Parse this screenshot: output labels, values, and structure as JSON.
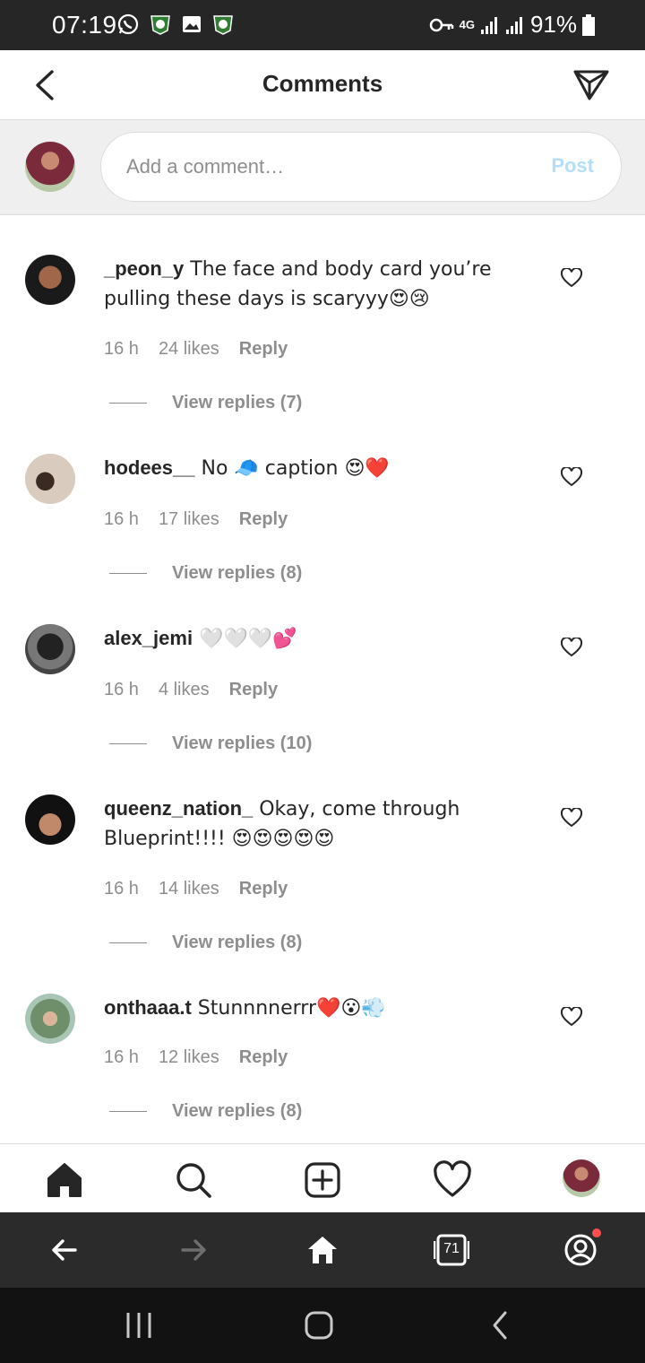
{
  "status_bar": {
    "time": "07:19",
    "network": "4G",
    "battery": "91%"
  },
  "header": {
    "title": "Comments"
  },
  "composer": {
    "placeholder": "Add a comment…",
    "post_label": "Post"
  },
  "comments": [
    {
      "username": "_peon_y",
      "text": " The face and body card you’re pulling these days is scaryyy😍😢",
      "time": "16 h",
      "likes": "24 likes",
      "reply": "Reply",
      "view_replies": "View replies (7)"
    },
    {
      "username": "hodees__",
      "text": " No 🧢 caption 😍❤️",
      "time": "16 h",
      "likes": "17 likes",
      "reply": "Reply",
      "view_replies": "View replies (8)"
    },
    {
      "username": "alex_jemi",
      "text": " 🤍🤍🤍💕",
      "time": "16 h",
      "likes": "4 likes",
      "reply": "Reply",
      "view_replies": "View replies (10)"
    },
    {
      "username": "queenz_nation_",
      "text": " Okay, come through Blueprint!!!! 😍😍😍😍😍",
      "time": "16 h",
      "likes": "14 likes",
      "reply": "Reply",
      "view_replies": "View replies (8)"
    },
    {
      "username": "onthaaa.t",
      "text": " Stunnnnerrr❤️😮💨",
      "time": "16 h",
      "likes": "12 likes",
      "reply": "Reply",
      "view_replies": "View replies (8)"
    }
  ],
  "browser_bar": {
    "tab_count": "71"
  },
  "colors": {
    "accent_disabled": "#b2dffc",
    "text_primary": "#262626",
    "text_secondary": "#8e8e8e",
    "notification_dot": "#ff4e4e"
  }
}
